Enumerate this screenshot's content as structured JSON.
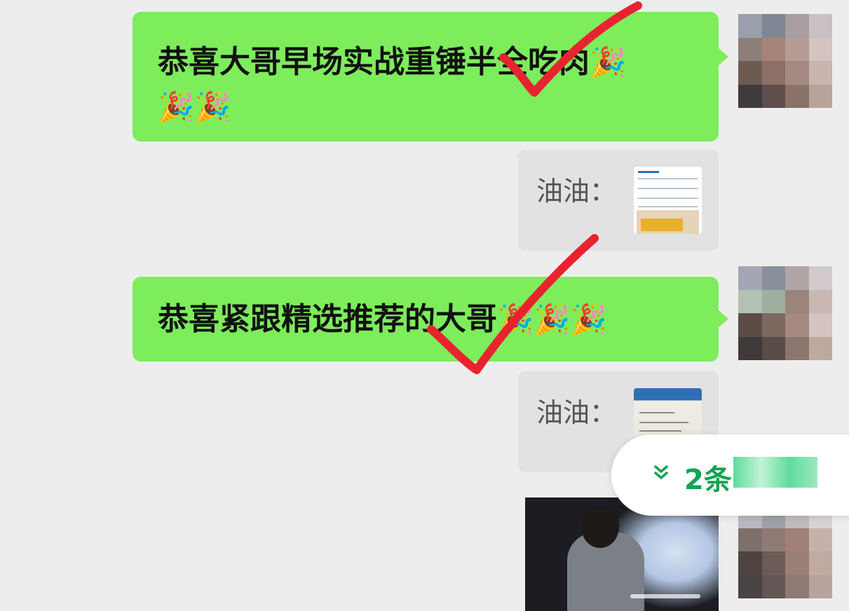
{
  "messages": [
    {
      "text": "恭喜大哥早场实战重锤半全吃肉",
      "emojis": [
        "🎉",
        "🎉",
        "🎉"
      ]
    },
    {
      "text": "恭喜紧跟精选推荐的大哥",
      "emojis": [
        "🎉",
        "🎉",
        "🎉"
      ]
    }
  ],
  "quotes": [
    {
      "sender": "油油："
    },
    {
      "sender": "油油："
    }
  ],
  "new_messages": {
    "chevron": "»",
    "count_text": "2条"
  },
  "colors": {
    "bubble": "#7ded5b",
    "background": "#ededed",
    "accent": "#13a551",
    "checkmark": "#e8232f"
  },
  "icons": {
    "scroll_down": "chevron-double-down-icon",
    "emoji": "party-popper-icon"
  }
}
